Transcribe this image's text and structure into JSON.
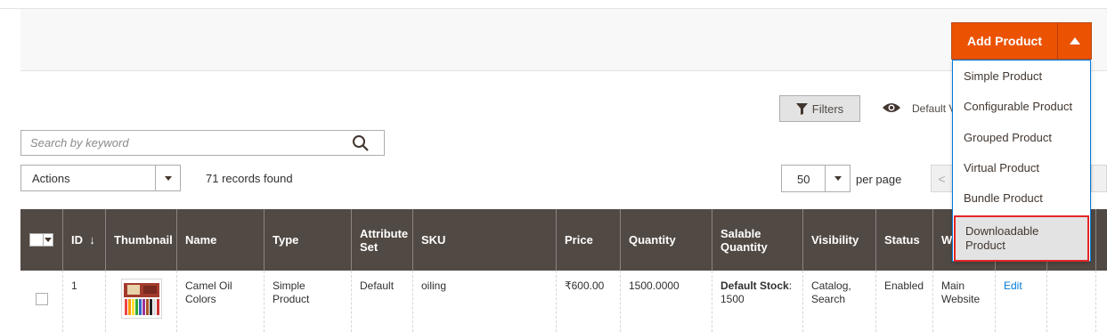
{
  "header": {
    "add_product_label": "Add Product",
    "add_product_menu": [
      "Simple Product",
      "Configurable Product",
      "Grouped Product",
      "Virtual Product",
      "Bundle Product",
      "Downloadable Product"
    ],
    "highlighted_menu_item": "Downloadable Product"
  },
  "toolbar": {
    "filters_label": "Filters",
    "default_view_label": "Default V",
    "search_placeholder": "Search by keyword",
    "actions_label": "Actions",
    "records_found": "71 records found",
    "per_page_value": "50",
    "per_page_label": "per page",
    "prev_label": "<"
  },
  "grid": {
    "columns": [
      "ID",
      "Thumbnail",
      "Name",
      "Type",
      "Attribute Set",
      "SKU",
      "Price",
      "Quantity",
      "Salable Quantity",
      "Visibility",
      "Status",
      "W"
    ],
    "sort_indicator": "↓",
    "rows": [
      {
        "id": "1",
        "name": "Camel Oil Colors",
        "type": "Simple Product",
        "attribute_set": "Default",
        "sku": "oiling",
        "price": "₹600.00",
        "quantity": "1500.0000",
        "salable_label": "Default Stock",
        "salable_value": ": 1500",
        "visibility": "Catalog, Search",
        "status": "Enabled",
        "websites": "Main Website",
        "action": "Edit"
      }
    ]
  },
  "colors": {
    "accent": "#eb5202",
    "header_bg": "#514943",
    "link": "#007bdb",
    "highlight_border": "#e22626"
  }
}
